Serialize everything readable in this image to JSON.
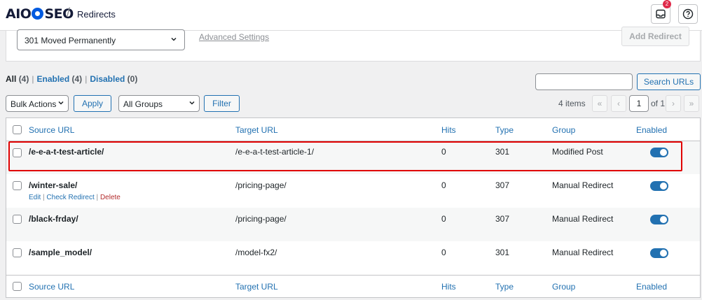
{
  "header": {
    "logo_text_1": "AIO",
    "logo_text_2": "SEO",
    "breadcrumb": "Redirects",
    "notifications_count": "2",
    "icons": [
      "inbox-icon",
      "help-icon"
    ]
  },
  "add_redirect": {
    "redirect_type_value": "301 Moved Permanently",
    "advanced_settings": "Advanced Settings",
    "add_button": "Add Redirect"
  },
  "views": {
    "all_label": "All",
    "all_count": "(4)",
    "enabled_label": "Enabled",
    "enabled_count": "(4)",
    "disabled_label": "Disabled",
    "disabled_count": "(0)"
  },
  "search": {
    "button": "Search URLs",
    "value": ""
  },
  "toolbar": {
    "bulk_actions": "Bulk Actions",
    "apply": "Apply",
    "groups": "All Groups",
    "filter": "Filter",
    "items": "4 items",
    "page": "1",
    "of_pages": "of 1",
    "first": "«",
    "prev": "‹",
    "next": "›",
    "last": "»"
  },
  "table": {
    "columns": [
      "Source URL",
      "Target URL",
      "Hits",
      "Type",
      "Group",
      "Enabled"
    ],
    "rows": [
      {
        "source": "/e-e-a-t-test-article/",
        "target": "/e-e-a-t-test-article-1/",
        "hits": "0",
        "type": "301",
        "group": "Modified Post",
        "enabled": true
      },
      {
        "source": "/winter-sale/",
        "target": "/pricing-page/",
        "hits": "0",
        "type": "307",
        "group": "Manual Redirect",
        "enabled": true,
        "row_actions": {
          "edit": "Edit",
          "check": "Check Redirect",
          "delete": "Delete",
          "sep": "|"
        }
      },
      {
        "source": "/black-frday/",
        "target": "/pricing-page/",
        "hits": "0",
        "type": "307",
        "group": "Manual Redirect",
        "enabled": true
      },
      {
        "source": "/sample_model/",
        "target": "/model-fx2/",
        "hits": "0",
        "type": "301",
        "group": "Manual Redirect",
        "enabled": true
      }
    ]
  },
  "colors": {
    "accent": "#2271b1",
    "highlight": "#e00000",
    "brand": "#005ae0",
    "badge": "#df2a4a"
  }
}
